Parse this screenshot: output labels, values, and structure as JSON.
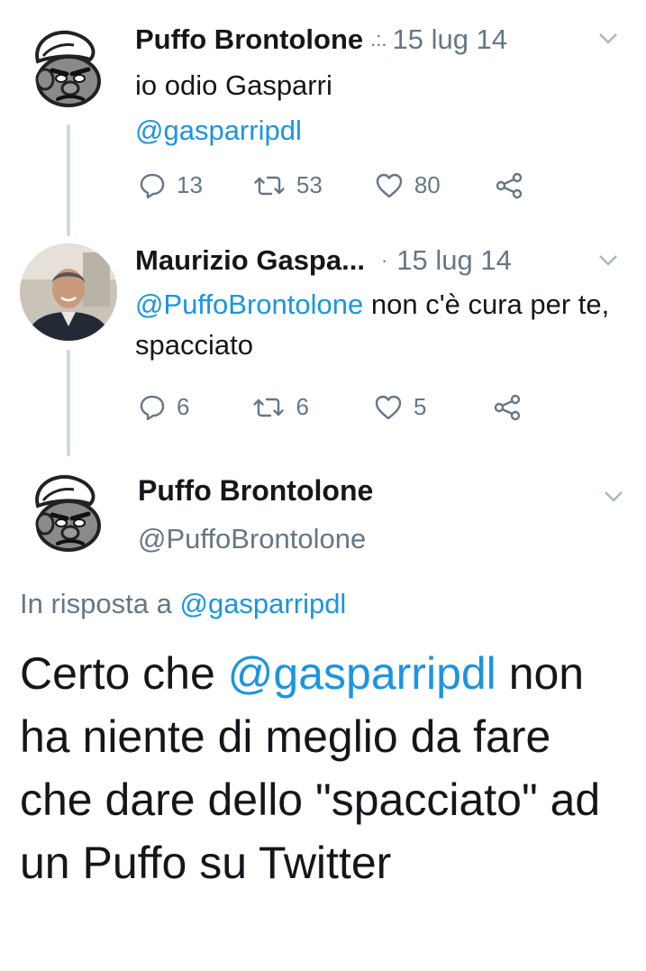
{
  "tweets": [
    {
      "name": "Puffo Brontolone",
      "separator": ".:.",
      "date": "15 lug 14",
      "text": "io odio Gasparri",
      "mention": "@gasparripdl",
      "replies": "13",
      "retweets": "53",
      "likes": "80"
    },
    {
      "name": "Maurizio Gaspa...",
      "separator": "·",
      "date": "15 lug 14",
      "mention": "@PuffoBrontolone",
      "text_rest": " non c'è cura per te, spacciato",
      "replies": "6",
      "retweets": "6",
      "likes": "5"
    }
  ],
  "main": {
    "name": "Puffo Brontolone",
    "handle": "@PuffoBrontolone",
    "reply_prefix": "In risposta a ",
    "reply_to": "@gasparripdl",
    "text_before": "Certo che ",
    "mention": "@gasparripdl",
    "text_after": " non ha niente di meglio da fare che dare dello \"spacciato\" ad un Puffo su Twitter"
  },
  "colors": {
    "link": "#1b95e0",
    "muted": "#657786",
    "thread": "#cfd9de"
  },
  "icons": [
    "smurf-avatar-icon",
    "person-avatar-icon",
    "reply-icon",
    "retweet-icon",
    "like-icon",
    "share-icon",
    "chevron-down-icon"
  ]
}
